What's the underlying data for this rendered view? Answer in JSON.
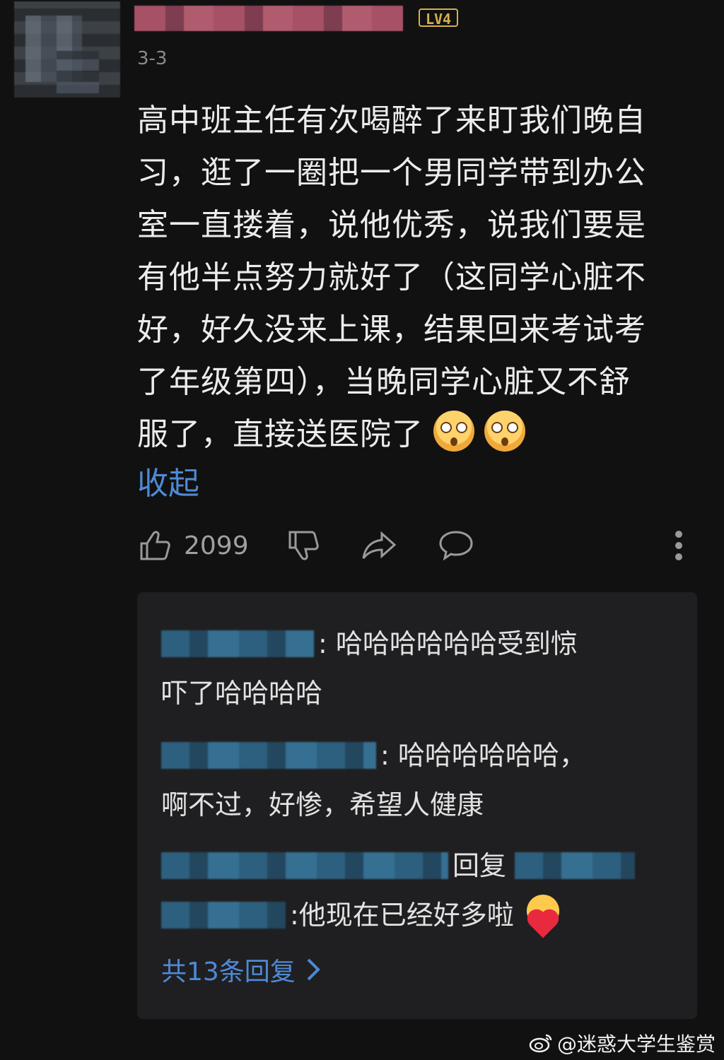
{
  "comment": {
    "level": "LV4",
    "date": "3-3",
    "text_lines": [
      "高中班主任有次喝醉了来盯我们晚自",
      "习，逛了一圈把一个男同学带到办公",
      "室一直搂着，说他优秀，说我们要是",
      "有他半点努力就好了（这同学心脏不",
      "好，好久没来上课，结果回来考试考",
      "了年级第四），当晚同学心脏又不舒",
      "服了，直接送医院了"
    ],
    "collapse_label": "收起",
    "like_count": "2099",
    "emoji_icons": [
      "scared-face-icon",
      "scared-face-icon"
    ]
  },
  "replies": {
    "items": [
      {
        "text_line1": ": 哈哈哈哈哈哈受到惊",
        "text_line2": "吓了哈哈哈哈"
      },
      {
        "text_line1": ": 哈哈哈哈哈哈，",
        "text_line2": "啊不过，好惨，希望人健康"
      },
      {
        "reply_word": "回复",
        "text": ":他现在已经好多啦"
      }
    ],
    "more_label": "共13条回复"
  },
  "watermark": {
    "text": "@迷惑大学生鉴赏"
  },
  "colors": {
    "background": "#111111",
    "link_blue": "#4e8ad6",
    "level_gold": "#d4b14a"
  }
}
